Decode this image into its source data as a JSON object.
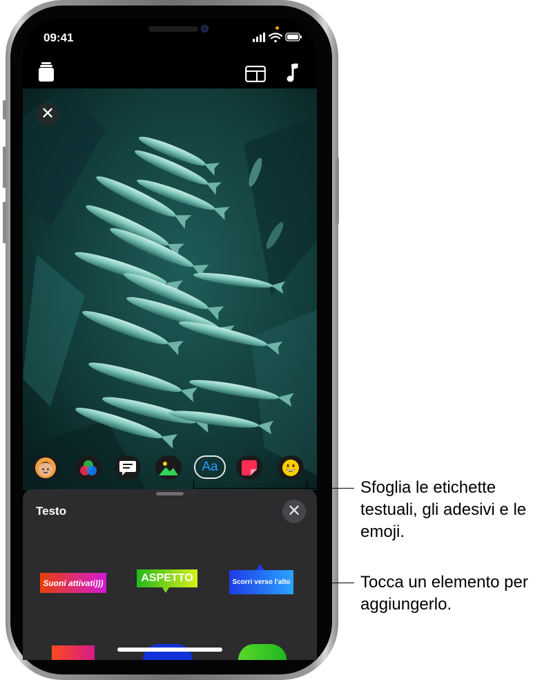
{
  "status_bar": {
    "time": "09:41"
  },
  "top_bar": {
    "icons": [
      "clips-library-icon",
      "aspect-ratio-icon",
      "music-note-icon"
    ]
  },
  "video": {
    "icons": [
      "close-icon"
    ]
  },
  "toolbar": {
    "items": [
      {
        "name": "memoji-icon"
      },
      {
        "name": "filters-icon"
      },
      {
        "name": "live-titles-icon"
      },
      {
        "name": "posters-icon"
      },
      {
        "name": "text-labels-icon",
        "label": "Aa",
        "selected": true
      },
      {
        "name": "stickers-icon"
      },
      {
        "name": "emoji-icon"
      }
    ]
  },
  "sheet": {
    "title": "Testo",
    "items": [
      {
        "text": "Suoni attivati)))",
        "colors": [
          "#e8400a",
          "#d21ad6"
        ]
      },
      {
        "text": "ASPETTO",
        "colors": [
          "#25b81a",
          "#d8f01b"
        ]
      },
      {
        "text": "Scorri verso l'alto",
        "colors": [
          "#1e3be6",
          "#2aa3ff"
        ]
      }
    ]
  },
  "callouts": [
    {
      "text": "Sfoglia le etichette testuali, gli adesivi e le emoji."
    },
    {
      "text": "Tocca un elemento per aggiungerlo."
    }
  ]
}
